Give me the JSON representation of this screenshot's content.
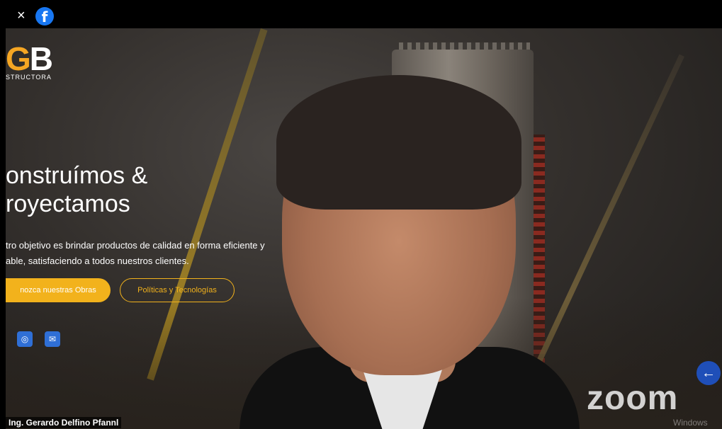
{
  "window": {
    "close_glyph": "×",
    "fb_glyph": "f"
  },
  "site": {
    "logo_text_g": "G",
    "logo_text_b": "B",
    "logo_sub": "STRUCTORA",
    "headline_line1": "onstruímos &",
    "headline_line2": "royectamos",
    "desc_line1": "tro objetivo es brindar productos de calidad en forma eficiente y",
    "desc_line2": "able, satisfaciendo a todos nuestros clientes.",
    "btn_primary": "nozca nuestras Obras",
    "btn_secondary": "Políticas y Tecnologías",
    "social_icons": [
      "instagram-icon",
      "mail-icon"
    ],
    "accent_color": "#f2b21c"
  },
  "meeting": {
    "participant_name": "Ing. Gerardo Delfino Pfannl",
    "watermark": "zoom",
    "os_watermark": "Windows",
    "arrow_glyph": "←"
  }
}
